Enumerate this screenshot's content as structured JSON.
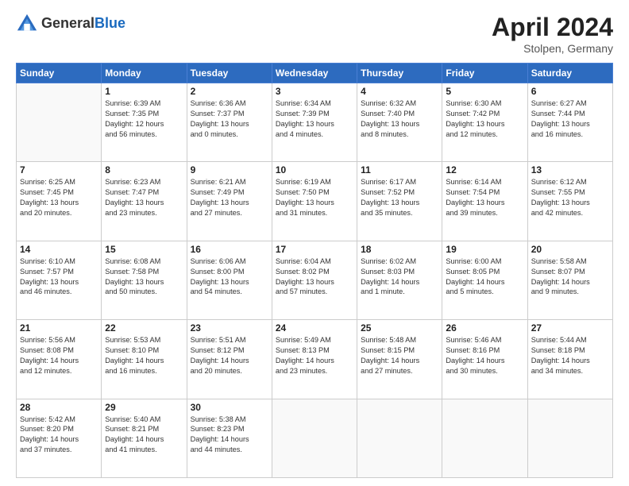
{
  "header": {
    "logo_line1": "General",
    "logo_line2": "Blue",
    "month": "April 2024",
    "location": "Stolpen, Germany"
  },
  "weekdays": [
    "Sunday",
    "Monday",
    "Tuesday",
    "Wednesday",
    "Thursday",
    "Friday",
    "Saturday"
  ],
  "weeks": [
    [
      {
        "day": "",
        "info": ""
      },
      {
        "day": "1",
        "info": "Sunrise: 6:39 AM\nSunset: 7:35 PM\nDaylight: 12 hours\nand 56 minutes."
      },
      {
        "day": "2",
        "info": "Sunrise: 6:36 AM\nSunset: 7:37 PM\nDaylight: 13 hours\nand 0 minutes."
      },
      {
        "day": "3",
        "info": "Sunrise: 6:34 AM\nSunset: 7:39 PM\nDaylight: 13 hours\nand 4 minutes."
      },
      {
        "day": "4",
        "info": "Sunrise: 6:32 AM\nSunset: 7:40 PM\nDaylight: 13 hours\nand 8 minutes."
      },
      {
        "day": "5",
        "info": "Sunrise: 6:30 AM\nSunset: 7:42 PM\nDaylight: 13 hours\nand 12 minutes."
      },
      {
        "day": "6",
        "info": "Sunrise: 6:27 AM\nSunset: 7:44 PM\nDaylight: 13 hours\nand 16 minutes."
      }
    ],
    [
      {
        "day": "7",
        "info": "Sunrise: 6:25 AM\nSunset: 7:45 PM\nDaylight: 13 hours\nand 20 minutes."
      },
      {
        "day": "8",
        "info": "Sunrise: 6:23 AM\nSunset: 7:47 PM\nDaylight: 13 hours\nand 23 minutes."
      },
      {
        "day": "9",
        "info": "Sunrise: 6:21 AM\nSunset: 7:49 PM\nDaylight: 13 hours\nand 27 minutes."
      },
      {
        "day": "10",
        "info": "Sunrise: 6:19 AM\nSunset: 7:50 PM\nDaylight: 13 hours\nand 31 minutes."
      },
      {
        "day": "11",
        "info": "Sunrise: 6:17 AM\nSunset: 7:52 PM\nDaylight: 13 hours\nand 35 minutes."
      },
      {
        "day": "12",
        "info": "Sunrise: 6:14 AM\nSunset: 7:54 PM\nDaylight: 13 hours\nand 39 minutes."
      },
      {
        "day": "13",
        "info": "Sunrise: 6:12 AM\nSunset: 7:55 PM\nDaylight: 13 hours\nand 42 minutes."
      }
    ],
    [
      {
        "day": "14",
        "info": "Sunrise: 6:10 AM\nSunset: 7:57 PM\nDaylight: 13 hours\nand 46 minutes."
      },
      {
        "day": "15",
        "info": "Sunrise: 6:08 AM\nSunset: 7:58 PM\nDaylight: 13 hours\nand 50 minutes."
      },
      {
        "day": "16",
        "info": "Sunrise: 6:06 AM\nSunset: 8:00 PM\nDaylight: 13 hours\nand 54 minutes."
      },
      {
        "day": "17",
        "info": "Sunrise: 6:04 AM\nSunset: 8:02 PM\nDaylight: 13 hours\nand 57 minutes."
      },
      {
        "day": "18",
        "info": "Sunrise: 6:02 AM\nSunset: 8:03 PM\nDaylight: 14 hours\nand 1 minute."
      },
      {
        "day": "19",
        "info": "Sunrise: 6:00 AM\nSunset: 8:05 PM\nDaylight: 14 hours\nand 5 minutes."
      },
      {
        "day": "20",
        "info": "Sunrise: 5:58 AM\nSunset: 8:07 PM\nDaylight: 14 hours\nand 9 minutes."
      }
    ],
    [
      {
        "day": "21",
        "info": "Sunrise: 5:56 AM\nSunset: 8:08 PM\nDaylight: 14 hours\nand 12 minutes."
      },
      {
        "day": "22",
        "info": "Sunrise: 5:53 AM\nSunset: 8:10 PM\nDaylight: 14 hours\nand 16 minutes."
      },
      {
        "day": "23",
        "info": "Sunrise: 5:51 AM\nSunset: 8:12 PM\nDaylight: 14 hours\nand 20 minutes."
      },
      {
        "day": "24",
        "info": "Sunrise: 5:49 AM\nSunset: 8:13 PM\nDaylight: 14 hours\nand 23 minutes."
      },
      {
        "day": "25",
        "info": "Sunrise: 5:48 AM\nSunset: 8:15 PM\nDaylight: 14 hours\nand 27 minutes."
      },
      {
        "day": "26",
        "info": "Sunrise: 5:46 AM\nSunset: 8:16 PM\nDaylight: 14 hours\nand 30 minutes."
      },
      {
        "day": "27",
        "info": "Sunrise: 5:44 AM\nSunset: 8:18 PM\nDaylight: 14 hours\nand 34 minutes."
      }
    ],
    [
      {
        "day": "28",
        "info": "Sunrise: 5:42 AM\nSunset: 8:20 PM\nDaylight: 14 hours\nand 37 minutes."
      },
      {
        "day": "29",
        "info": "Sunrise: 5:40 AM\nSunset: 8:21 PM\nDaylight: 14 hours\nand 41 minutes."
      },
      {
        "day": "30",
        "info": "Sunrise: 5:38 AM\nSunset: 8:23 PM\nDaylight: 14 hours\nand 44 minutes."
      },
      {
        "day": "",
        "info": ""
      },
      {
        "day": "",
        "info": ""
      },
      {
        "day": "",
        "info": ""
      },
      {
        "day": "",
        "info": ""
      }
    ]
  ]
}
